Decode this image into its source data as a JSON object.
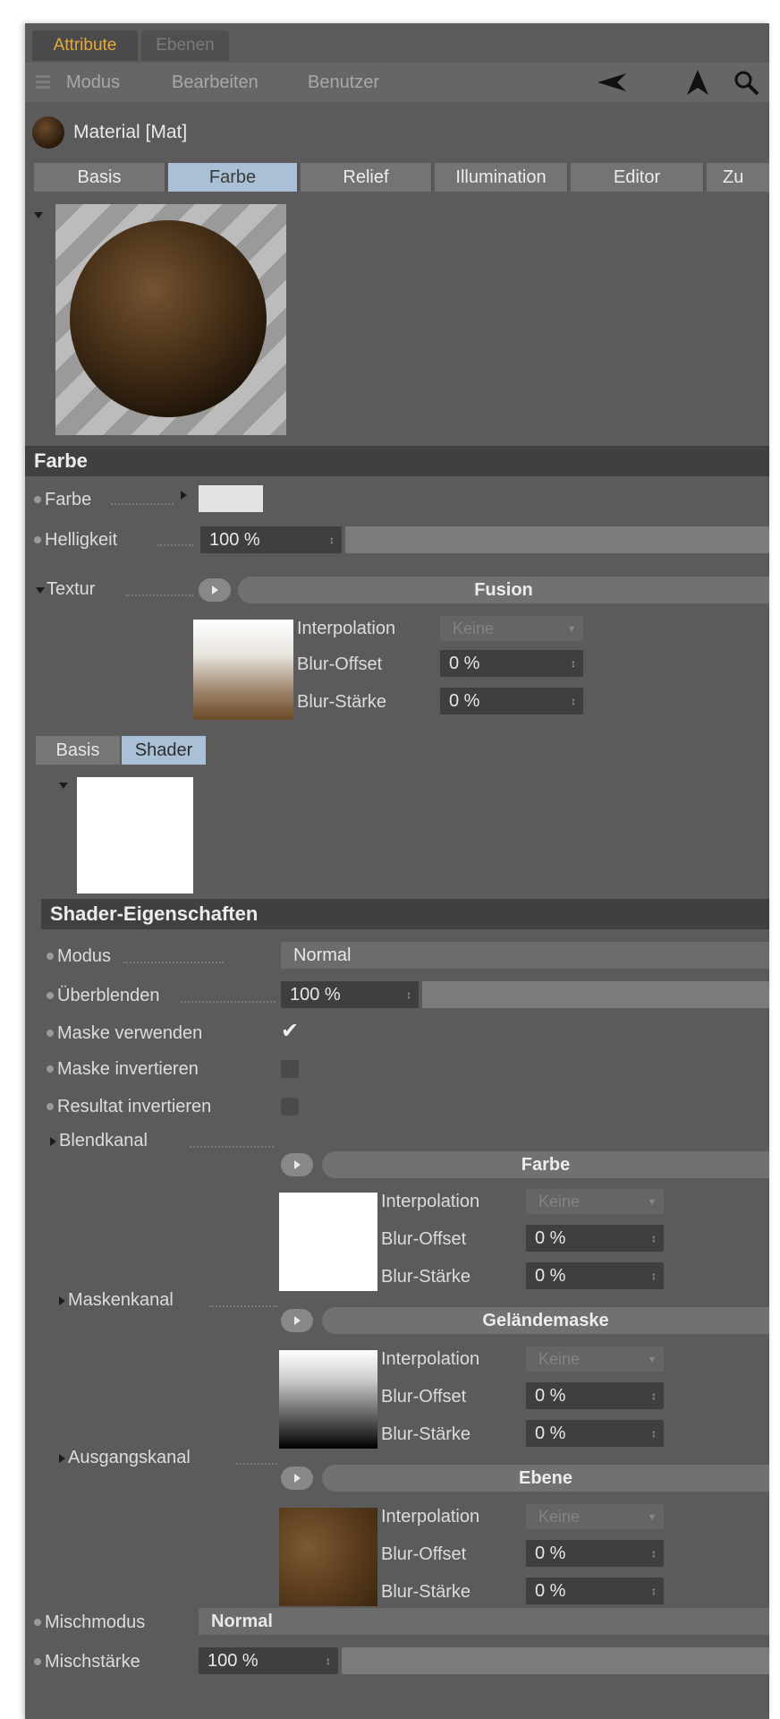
{
  "top_tabs": {
    "attribute": "Attribute",
    "ebenen": "Ebenen"
  },
  "menu": {
    "modus": "Modus",
    "bearbeiten": "Bearbeiten",
    "benutzer": "Benutzer"
  },
  "material": {
    "name": "Material [Mat]"
  },
  "material_tabs": [
    "Basis",
    "Farbe",
    "Relief",
    "Illumination",
    "Editor",
    "Zu"
  ],
  "active_material_tab": "Farbe",
  "farbe_section": {
    "title": "Farbe",
    "farbe_label": "Farbe",
    "helligkeit_label": "Helligkeit",
    "helligkeit_value": "100 %",
    "textur_label": "Textur",
    "textur_shader": "Fusion",
    "interpolation_label": "Interpolation",
    "interpolation_value": "Keine",
    "blur_offset_label": "Blur-Offset",
    "blur_offset_value": "0 %",
    "blur_staerke_label": "Blur-Stärke",
    "blur_staerke_value": "0 %"
  },
  "sub_tabs": [
    "Basis",
    "Shader"
  ],
  "active_sub_tab": "Shader",
  "shader_section": {
    "title": "Shader-Eigenschaften",
    "modus_label": "Modus",
    "modus_value": "Normal",
    "ueberblenden_label": "Überblenden",
    "ueberblenden_value": "100 %",
    "maske_verwenden_label": "Maske verwenden",
    "maske_verwenden_checked": true,
    "maske_invertieren_label": "Maske invertieren",
    "resultat_invertieren_label": "Resultat invertieren",
    "channels": [
      {
        "label": "Blendkanal",
        "shader": "Farbe",
        "interpolation_label": "Interpolation",
        "interpolation_value": "Keine",
        "blur_offset_label": "Blur-Offset",
        "blur_offset_value": "0 %",
        "blur_staerke_label": "Blur-Stärke",
        "blur_staerke_value": "0 %"
      },
      {
        "label": "Maskenkanal",
        "shader": "Geländemaske",
        "interpolation_label": "Interpolation",
        "interpolation_value": "Keine",
        "blur_offset_label": "Blur-Offset",
        "blur_offset_value": "0 %",
        "blur_staerke_label": "Blur-Stärke",
        "blur_staerke_value": "0 %"
      },
      {
        "label": "Ausgangskanal",
        "shader": "Ebene",
        "interpolation_label": "Interpolation",
        "interpolation_value": "Keine",
        "blur_offset_label": "Blur-Offset",
        "blur_offset_value": "0 %",
        "blur_staerke_label": "Blur-Stärke",
        "blur_staerke_value": "0 %"
      }
    ]
  },
  "footer": {
    "mischmodus_label": "Mischmodus",
    "mischmodus_value": "Normal",
    "mischstaerke_label": "Mischstärke",
    "mischstaerke_value": "100 %"
  },
  "colors": {
    "accent_tab_text": "#e7a93a",
    "active_tab": "#a9c0d7",
    "panel": "#5b5b5b"
  }
}
